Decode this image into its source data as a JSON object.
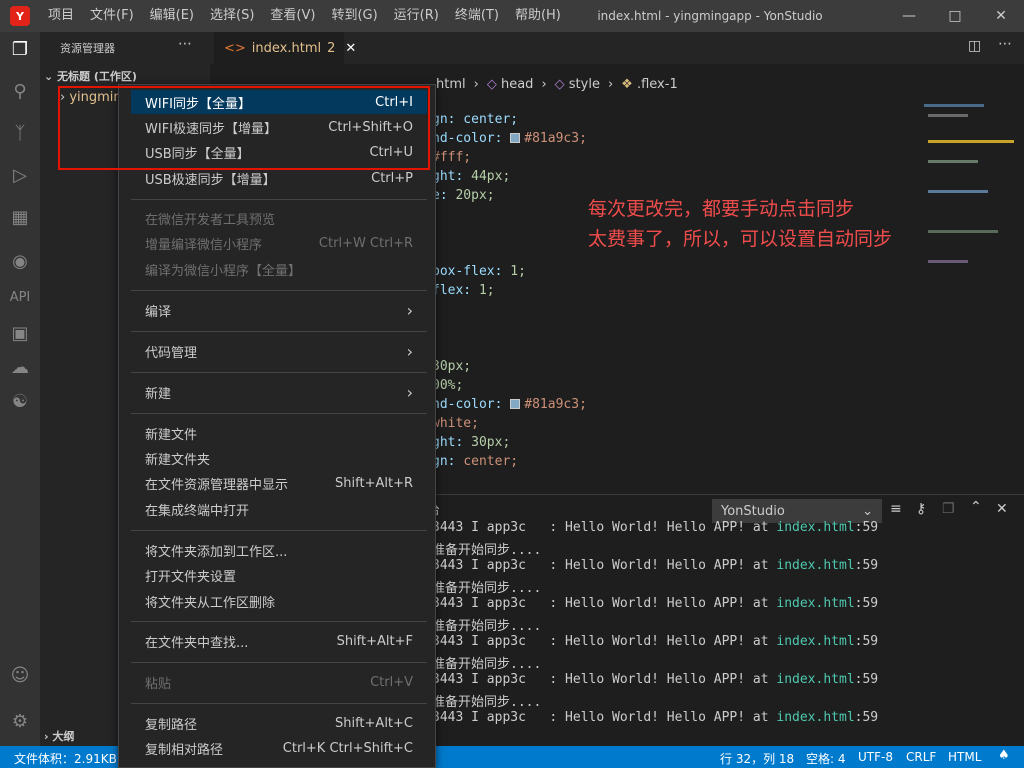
{
  "title_bar": {
    "logo": "Y",
    "menu": [
      "项目",
      "文件(F)",
      "编辑(E)",
      "选择(S)",
      "查看(V)",
      "转到(G)",
      "运行(R)",
      "终端(T)",
      "帮助(H)"
    ],
    "window_title": "index.html - yingmingapp - YonStudio"
  },
  "activity_bar": {
    "api_label": "API"
  },
  "sidebar": {
    "header": "资源管理器",
    "workspace": "无标题 (工作区)",
    "folder": "yingmin",
    "outline": "大纲"
  },
  "tab": {
    "name": "index.html",
    "badge": "2"
  },
  "breadcrumb": {
    "items": [
      "html",
      "head",
      "style",
      ".flex-1"
    ]
  },
  "code": {
    "l1": "gn: center;",
    "l2_a": "nd-color: ",
    "l2_b": "#81a9c3;",
    "l3": "#fff;",
    "l4_a": "ght: ",
    "l4_b": "44px;",
    "l5_a": "e: ",
    "l5_b": "20px;",
    "l6_a": "box-flex: ",
    "l6_b": "1;",
    "l7_a": "flex: ",
    "l7_b": "1;",
    "l8": "30px;",
    "l9": "00%;",
    "l10_a": "nd-color: ",
    "l10_b": "#81a9c3;",
    "l11": "white;",
    "l12_a": "ght: ",
    "l12_b": "30px;",
    "l13_a": "gn: ",
    "l13_b": "center;"
  },
  "annotation": {
    "line1": "每次更改完，都要手动点击同步",
    "line2": "太费事了，所以，可以设置自动同步"
  },
  "panel": {
    "tab_fragment": "台",
    "dropdown": "YonStudio",
    "log_line": "3443 I app3c   : Hello World! Hello APP! at ",
    "log_link": "index.html",
    "log_suffix": ":59",
    "sync_line": "准备开始同步...."
  },
  "context_menu": {
    "items": [
      {
        "label": "WIFI同步【全量】",
        "shortcut": "Ctrl+I"
      },
      {
        "label": "WIFI极速同步【增量】",
        "shortcut": "Ctrl+Shift+O"
      },
      {
        "label": "USB同步【全量】",
        "shortcut": "Ctrl+U"
      },
      {
        "label": "USB极速同步【增量】",
        "shortcut": "Ctrl+P"
      },
      {
        "label": "在微信开发者工具预览",
        "shortcut": ""
      },
      {
        "label": "增量编译微信小程序",
        "shortcut": "Ctrl+W Ctrl+R"
      },
      {
        "label": "编译为微信小程序【全量】",
        "shortcut": ""
      },
      {
        "label": "编译",
        "shortcut": "›"
      },
      {
        "label": "代码管理",
        "shortcut": "›"
      },
      {
        "label": "新建",
        "shortcut": "›"
      },
      {
        "label": "新建文件",
        "shortcut": ""
      },
      {
        "label": "新建文件夹",
        "shortcut": ""
      },
      {
        "label": "在文件资源管理器中显示",
        "shortcut": "Shift+Alt+R"
      },
      {
        "label": "在集成终端中打开",
        "shortcut": ""
      },
      {
        "label": "将文件夹添加到工作区...",
        "shortcut": ""
      },
      {
        "label": "打开文件夹设置",
        "shortcut": ""
      },
      {
        "label": "将文件夹从工作区删除",
        "shortcut": ""
      },
      {
        "label": "在文件夹中查找...",
        "shortcut": "Shift+Alt+F"
      },
      {
        "label": "粘贴",
        "shortcut": "Ctrl+V"
      },
      {
        "label": "复制路径",
        "shortcut": "Shift+Alt+C"
      },
      {
        "label": "复制相对路径",
        "shortcut": "Ctrl+K Ctrl+Shift+C"
      }
    ]
  },
  "status_bar": {
    "left": "文件体积：2.91KB，",
    "position": "行 32，列 18",
    "spaces": "空格: 4",
    "encoding": "UTF-8",
    "eol": "CRLF",
    "language": "HTML"
  },
  "colors": {
    "accent": "#007acc",
    "selected": "#04395e",
    "annotation": "#f14c4c",
    "swatch": "#81a9c3"
  }
}
